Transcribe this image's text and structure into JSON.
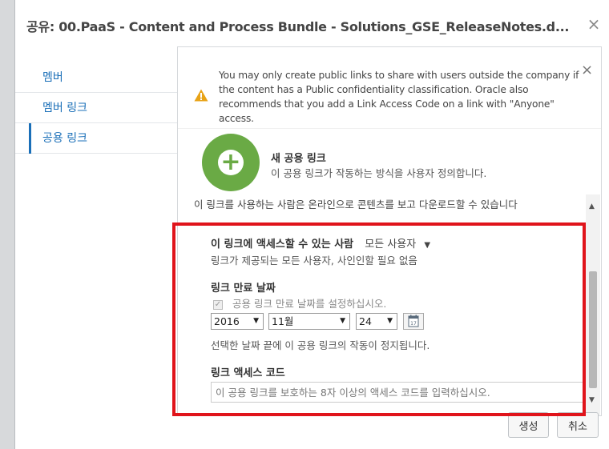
{
  "dialog": {
    "title": "공유: 00.PaaS - Content and Process Bundle - Solutions_GSE_ReleaseNotes.d...",
    "close_glyph": "×"
  },
  "nav": {
    "items": [
      {
        "label": "멤버",
        "active": false
      },
      {
        "label": "멤버 링크",
        "active": false
      },
      {
        "label": "공용 링크",
        "active": true
      }
    ]
  },
  "notice": {
    "text": "You may only create public links to share with users outside the company if the content has a Public confidentiality classification. Oracle also recommends that you add a Link Access Code on a link with \"Anyone\" access.",
    "close_glyph": "×",
    "icon": "warning-icon"
  },
  "new_link": {
    "icon": "add-circle-icon",
    "title": "새 공용 링크",
    "description": "이 공용 링크가 작동하는 방식을 사용자 정의합니다."
  },
  "form": {
    "cutoff_text": "이 링크를 사용하는 사람은 온라인으로 콘텐츠를 보고 다운로드할 수 있습니다",
    "access_label": "이 링크에 액세스할 수 있는 사람",
    "access_value": "모든 사용자",
    "access_description": "링크가 제공되는 모든 사용자, 사인인할 필요 없음",
    "expiry_title": "링크 만료 날짜",
    "expiry_checkbox_label": "공용 링크 만료 날짜를 설정하십시오.",
    "expiry_checked": true,
    "year": "2016",
    "month": "11월",
    "day": "24",
    "calendar_icon": "calendar-icon",
    "calendar_day": "17",
    "date_description": "선택한 날짜 끝에 이 공용 링크의 작동이 정지됩니다.",
    "code_title": "링크 액세스 코드",
    "code_placeholder": "이 공용 링크를 보호하는 8자 이상의 액세스 코드를 입력하십시오."
  },
  "buttons": {
    "create": "생성",
    "cancel": "취소"
  },
  "colors": {
    "accent": "#1a6fb8",
    "add_green": "#6aaa45",
    "warning": "#e8a317",
    "highlight": "#e0141b"
  }
}
